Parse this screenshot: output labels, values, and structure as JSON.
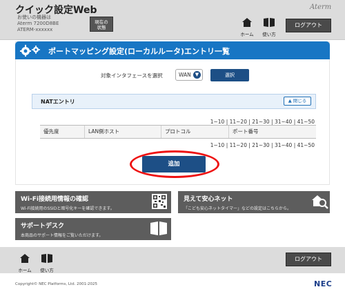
{
  "header": {
    "app_title": "クイック設定Web",
    "model_line1": "お使いの機器は",
    "model_line2": "Aterm 7200D8BE",
    "model_line3": "ATERM-xxxxxx",
    "status_button_line1": "現在の",
    "status_button_line2": "状態",
    "brand": "Aterm",
    "home_label": "ホーム",
    "guide_label": "使い方",
    "logout_label": "ログアウト"
  },
  "page": {
    "title": "ポートマッピング設定(ローカルルータ)エントリ一覧",
    "interface_label": "対象インタフェースを選択",
    "interface_value": "WAN",
    "select_button": "選択"
  },
  "nat": {
    "title": "NATエントリ",
    "close_label": "閉じる",
    "pager": [
      "1~10",
      "11~20",
      "21~30",
      "31~40",
      "41~50"
    ],
    "columns": [
      "優先度",
      "LAN側ホスト",
      "プロトコル",
      "ポート番号"
    ],
    "add_button": "追加"
  },
  "tiles": {
    "wifi": {
      "title": "Wi-Fi接続用情報の確認",
      "desc": "Wi-Fi接続用のSSIDと暗号化キーを確認できます。"
    },
    "support": {
      "title": "サポートデスク",
      "desc": "本商品のサポート情報をご覧いただけます。"
    },
    "safety": {
      "title": "見えて安心ネット",
      "desc": "「こども安心ネットタイマー」などの設定はこちらから。"
    }
  },
  "footer": {
    "home_label": "ホーム",
    "guide_label": "使い方",
    "logout_label": "ログアウト",
    "copyright": "Copyright© NEC Platforms, Ltd. 2001-2025",
    "nec": "NEC"
  },
  "colors": {
    "header_bg": "#dcdcdc",
    "title_bar": "#1876c4",
    "primary_button": "#1d4f86",
    "tile_bg": "#5d5d5d",
    "highlight": "#ee1111"
  },
  "icons": [
    "gear-icon",
    "home-icon",
    "book-icon",
    "chevron-down-icon",
    "chevron-up-icon",
    "qr-code-icon",
    "magnifier-house-icon"
  ]
}
